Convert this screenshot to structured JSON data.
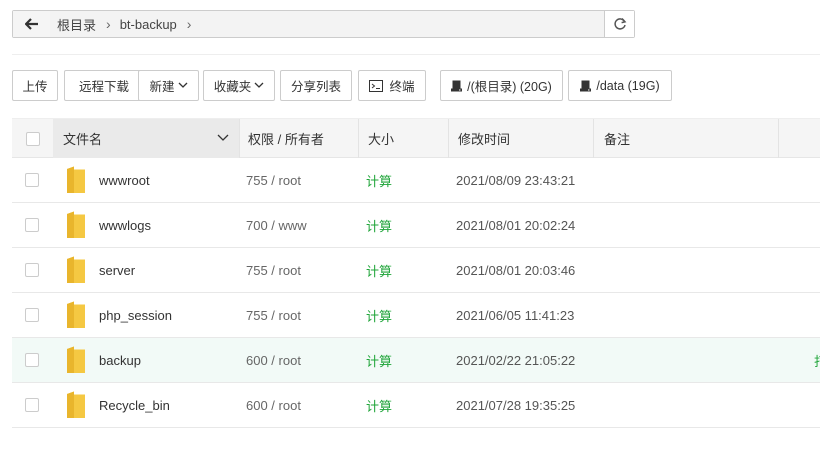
{
  "pathbar": {
    "crumbs": [
      "根目录",
      "bt-backup"
    ]
  },
  "toolbar": {
    "upload": "上传",
    "remote_download": "远程下载",
    "new": "新建",
    "favorites": "收藏夹",
    "share_list": "分享列表",
    "terminal": "终端",
    "disk_root": "/(根目录) (20G)",
    "disk_data": "/data (19G)"
  },
  "table": {
    "headers": {
      "name": "文件名",
      "perm": "权限 / 所有者",
      "size": "大小",
      "mtime": "修改时间",
      "note": "备注"
    },
    "rows": [
      {
        "name": "wwwroot",
        "perm": "755 / root",
        "size": "计算",
        "mtime": "2021/08/09 23:43:21",
        "note": ""
      },
      {
        "name": "wwwlogs",
        "perm": "700 / www",
        "size": "计算",
        "mtime": "2021/08/01 20:02:24",
        "note": ""
      },
      {
        "name": "server",
        "perm": "755 / root",
        "size": "计算",
        "mtime": "2021/08/01 20:03:46",
        "note": ""
      },
      {
        "name": "php_session",
        "perm": "755 / root",
        "size": "计算",
        "mtime": "2021/06/05 11:41:23",
        "note": ""
      },
      {
        "name": "backup",
        "perm": "600 / root",
        "size": "计算",
        "mtime": "2021/02/22 21:05:22",
        "note": ""
      },
      {
        "name": "Recycle_bin",
        "perm": "600 / root",
        "size": "计算",
        "mtime": "2021/07/28 19:35:25",
        "note": ""
      }
    ],
    "hover_row_edge_text": "打"
  },
  "colors": {
    "accent_green": "#20a53a",
    "folder_yellow": "#f5c842",
    "hover_row_bg": "#f2faf7"
  }
}
